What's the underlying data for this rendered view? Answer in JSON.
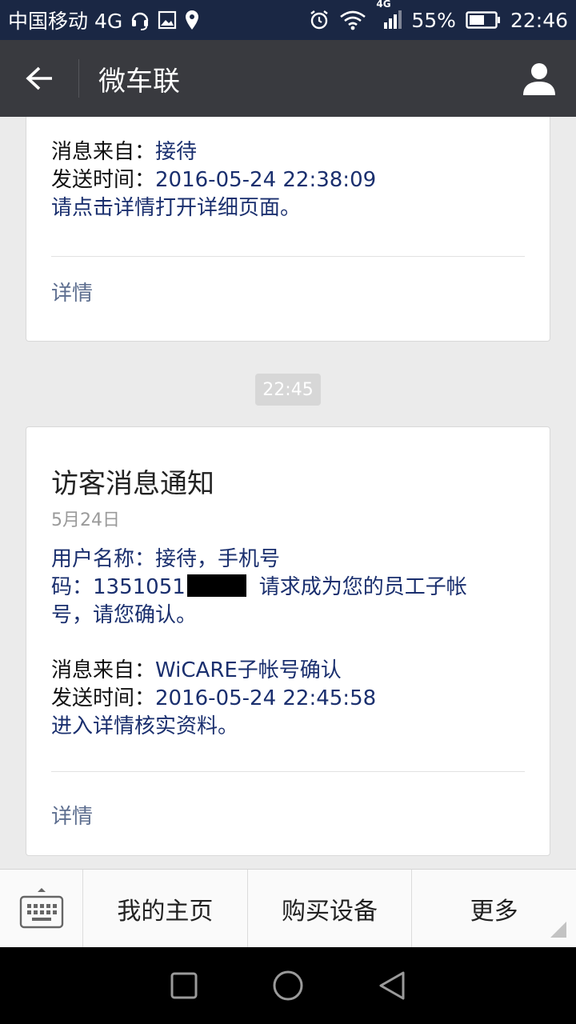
{
  "status_bar": {
    "carrier": "中国移动 4G",
    "network_small": "4G",
    "battery": "55%",
    "time": "22:46"
  },
  "header": {
    "title": "微车联"
  },
  "card_1": {
    "source_label": "消息来自：",
    "source_value": "接待",
    "time_label": "发送时间：",
    "time_value": "2016-05-24 22:38:09",
    "hint": "请点击详情打开详细页面。",
    "detail": "详情"
  },
  "time_chip": "22:45",
  "card_2": {
    "title": "访客消息通知",
    "date": "5月24日",
    "line1": "用户名称：接待，手机号",
    "line2_prefix": "码：1351051",
    "line2_suffix": "请求成为您的员工子帐",
    "line3": "号，请您确认。",
    "source_label": "消息来自：",
    "source_value": "WiCARE子帐号确认",
    "time_label": "发送时间：",
    "time_value": "2016-05-24 22:45:58",
    "hint": "进入详情核实资料。",
    "detail": "详情"
  },
  "bottom_menu": {
    "items": [
      "我的主页",
      "购买设备",
      "更多"
    ]
  },
  "colors": {
    "status_bar_bg": "#1a2744",
    "header_bg": "#393a3f",
    "link_blue": "#1a2f6e"
  }
}
